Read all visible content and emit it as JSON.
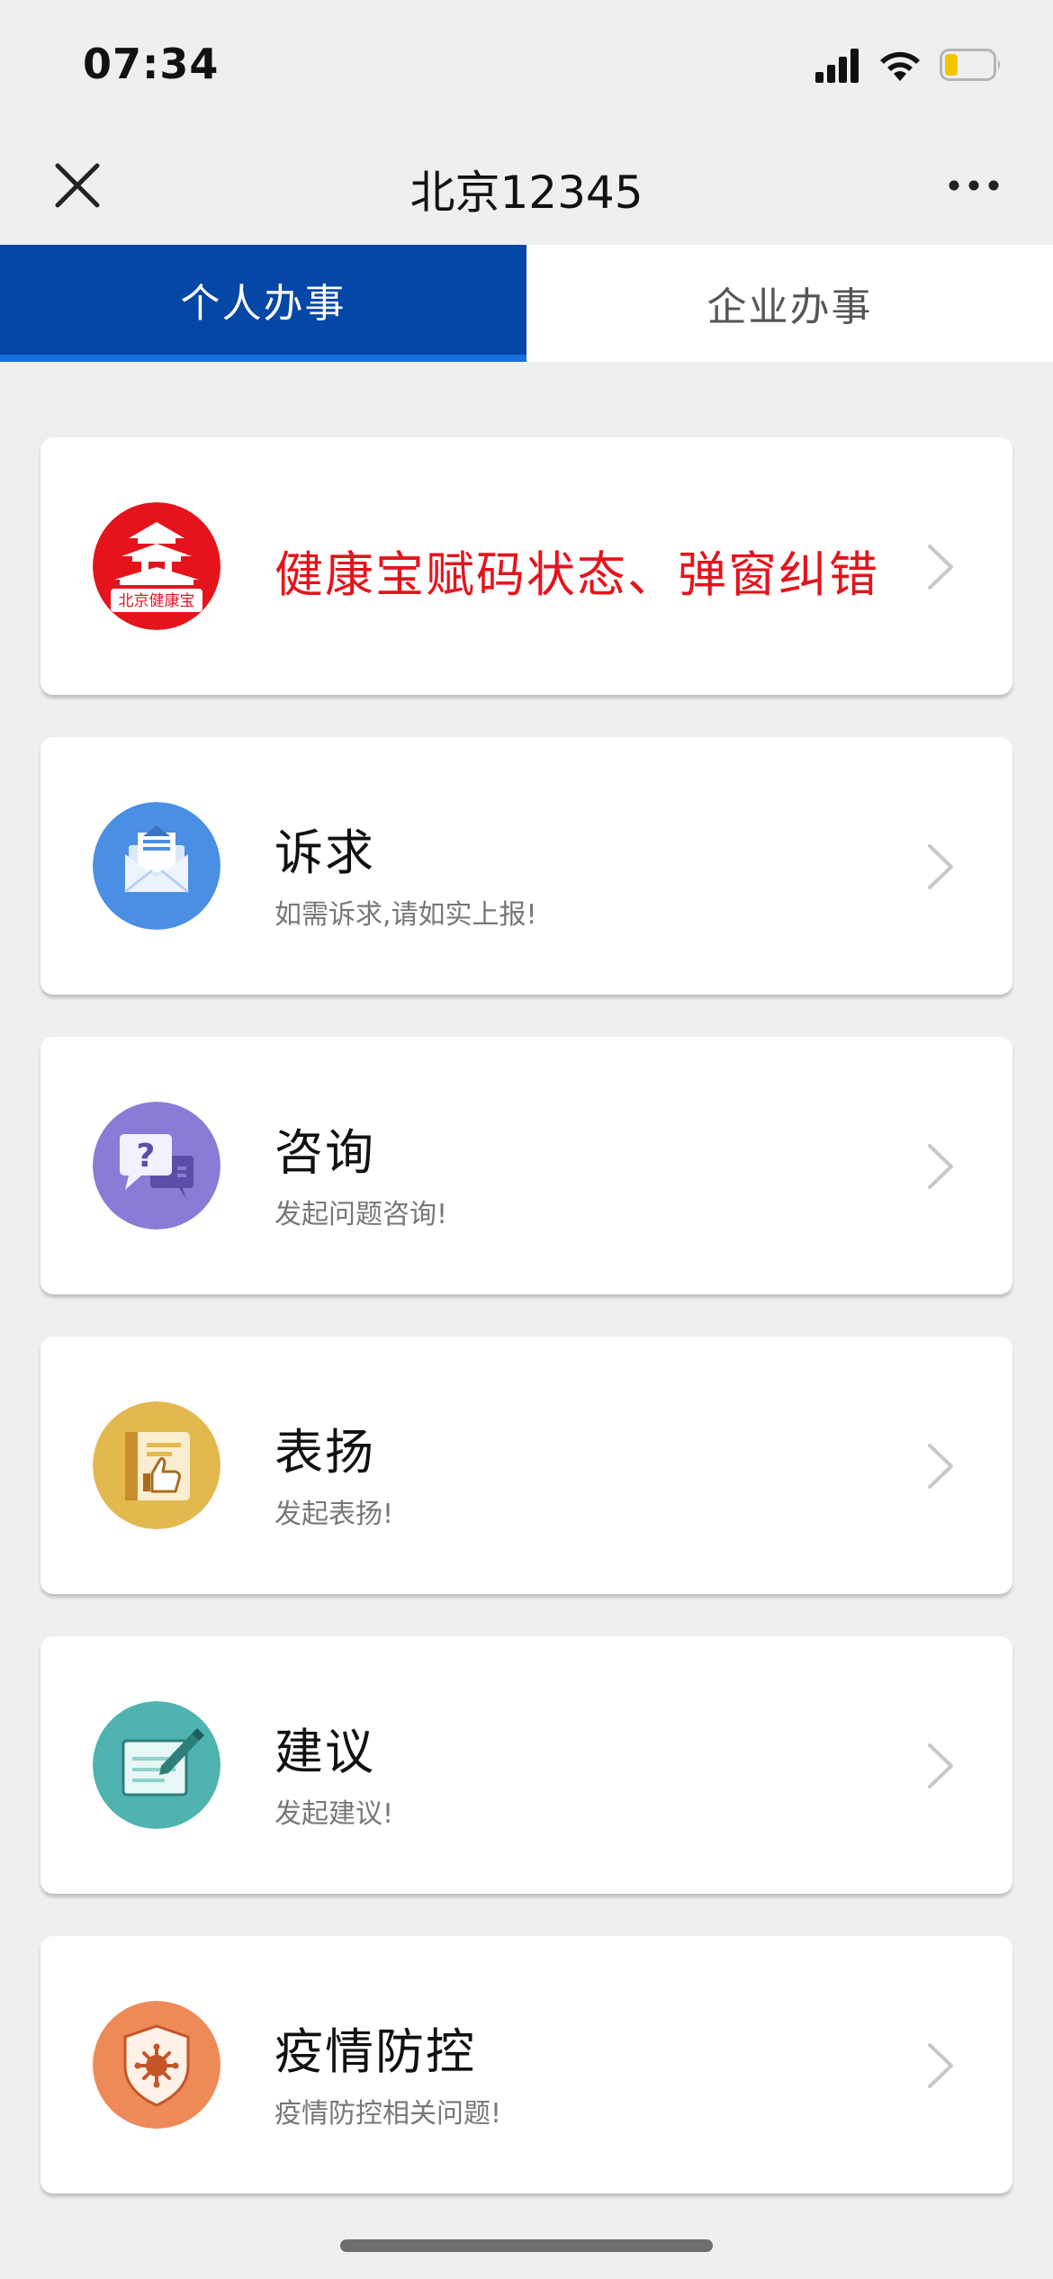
{
  "status_bar": {
    "time": "07:34"
  },
  "nav": {
    "title": "北京12345"
  },
  "tabs": [
    {
      "label": "个人办事",
      "active": true
    },
    {
      "label": "企业办事",
      "active": false
    }
  ],
  "cards": [
    {
      "title": "健康宝赋码状态、弹窗纠错",
      "subtitle": "",
      "icon": "beijing-health-kit-icon",
      "logo_text": "北京健康宝",
      "color": "#e5141c",
      "highlight": true
    },
    {
      "title": "诉求",
      "subtitle": "如需诉求,请如实上报!",
      "icon": "envelope-icon",
      "color": "#4a8fe4"
    },
    {
      "title": "咨询",
      "subtitle": "发起问题咨询!",
      "icon": "question-chat-icon",
      "color": "#8a7bd6"
    },
    {
      "title": "表扬",
      "subtitle": "发起表扬!",
      "icon": "thumbs-up-icon",
      "color": "#e3b84e"
    },
    {
      "title": "建议",
      "subtitle": "发起建议!",
      "icon": "edit-note-icon",
      "color": "#4fb3b0"
    },
    {
      "title": "疫情防控",
      "subtitle": "疫情防控相关问题!",
      "icon": "virus-shield-icon",
      "color": "#ee8a58"
    }
  ]
}
